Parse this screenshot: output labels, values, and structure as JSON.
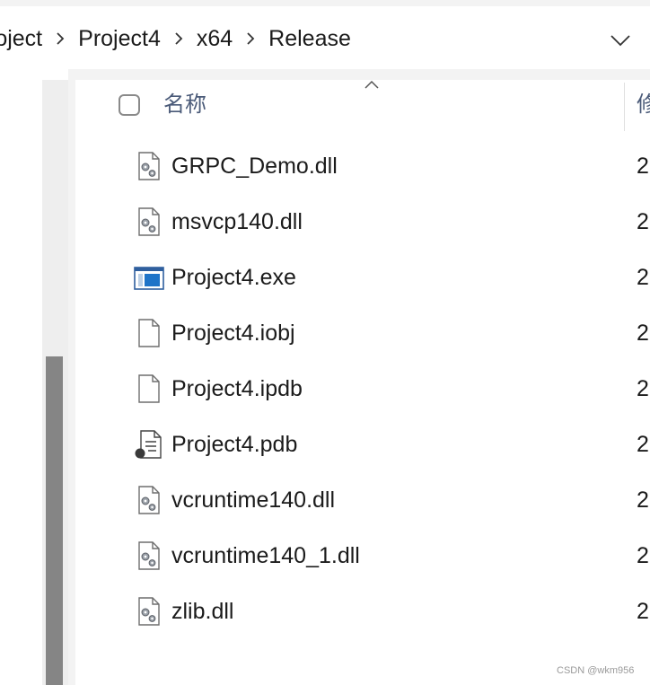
{
  "breadcrumb": [
    {
      "label": "roject"
    },
    {
      "label": "Project4"
    },
    {
      "label": "x64"
    },
    {
      "label": "Release"
    }
  ],
  "icons": {
    "separator": "chevron-right-icon",
    "dropdown": "chevron-down-icon",
    "sort": "sort-ascending-icon",
    "dll": "dll-file-icon",
    "exe": "application-icon",
    "generic": "blank-file-icon",
    "pdb": "pdb-file-icon"
  },
  "header": {
    "name_label": "名称",
    "modified_label": "修"
  },
  "files": [
    {
      "name": "GRPC_Demo.dll",
      "date": "2",
      "icon": "dll"
    },
    {
      "name": "msvcp140.dll",
      "date": "2",
      "icon": "dll"
    },
    {
      "name": "Project4.exe",
      "date": "2",
      "icon": "exe"
    },
    {
      "name": "Project4.iobj",
      "date": "2",
      "icon": "generic"
    },
    {
      "name": "Project4.ipdb",
      "date": "2",
      "icon": "generic"
    },
    {
      "name": "Project4.pdb",
      "date": "2",
      "icon": "pdb"
    },
    {
      "name": "vcruntime140.dll",
      "date": "2",
      "icon": "dll"
    },
    {
      "name": "vcruntime140_1.dll",
      "date": "2",
      "icon": "dll"
    },
    {
      "name": "zlib.dll",
      "date": "2",
      "icon": "dll"
    }
  ],
  "watermark": "CSDN @wkm956"
}
